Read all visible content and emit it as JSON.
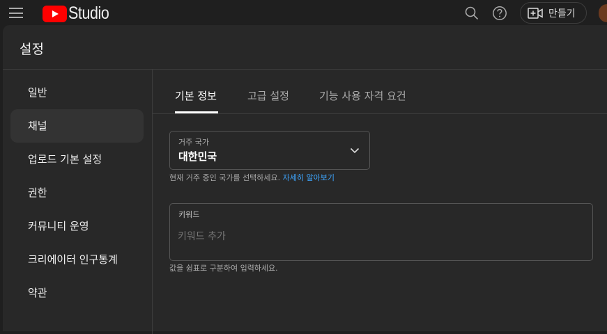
{
  "app": {
    "logo_text": "Studio"
  },
  "topbar": {
    "create_label": "만들기"
  },
  "dialog": {
    "title": "설정"
  },
  "sidebar": {
    "items": [
      {
        "label": "일반"
      },
      {
        "label": "채널",
        "active": true
      },
      {
        "label": "업로드 기본 설정"
      },
      {
        "label": "권한"
      },
      {
        "label": "커뮤니티 운영"
      },
      {
        "label": "크리에이터 인구통계"
      },
      {
        "label": "약관"
      }
    ]
  },
  "tabs": [
    {
      "label": "기본 정보",
      "active": true
    },
    {
      "label": "고급 설정"
    },
    {
      "label": "기능 사용 자격 요건"
    }
  ],
  "country": {
    "label": "거주 국가",
    "value": "대한민국",
    "help": "현재 거주 중인 국가를 선택하세요.",
    "help_link": "자세히 알아보기"
  },
  "keywords": {
    "label": "키워드",
    "placeholder": "키워드 추가",
    "help": "값을 쉼표로 구분하여 입력하세요."
  },
  "colors": {
    "accent": "#3ea6ff",
    "brand": "#ff0000",
    "background": "#282828"
  },
  "icons": [
    "menu-icon",
    "youtube-logo-icon",
    "search-icon",
    "help-icon",
    "create-video-icon",
    "chevron-down-icon"
  ]
}
